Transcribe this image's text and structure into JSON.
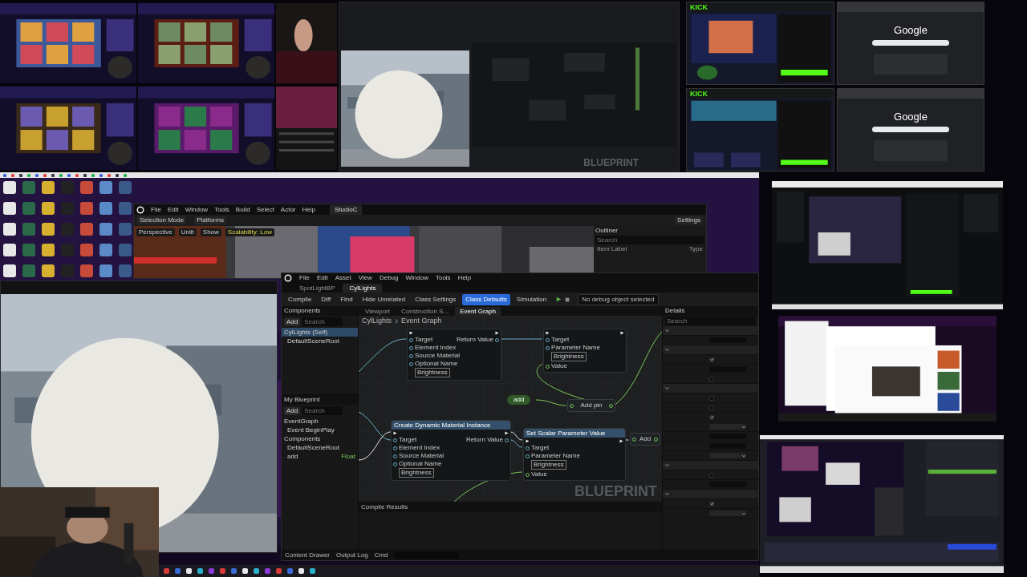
{
  "top_monitors": {
    "blueprint_preview": {
      "watermark": "BLUEPRINT"
    },
    "kick_windows": [
      {
        "logo": "KICK"
      },
      {
        "logo": "KICK"
      }
    ],
    "google_windows": [
      {
        "logo": "Google"
      },
      {
        "logo": "Google"
      }
    ]
  },
  "level_editor": {
    "menu": [
      "File",
      "Edit",
      "Window",
      "Tools",
      "Build",
      "Select",
      "Actor",
      "Help"
    ],
    "tab": "StudioC",
    "toolbar": [
      "Selection Mode",
      "Platforms",
      "Settings"
    ],
    "viewport_bar": [
      "Perspective",
      "Unlit",
      "Show",
      "Scalability: Low"
    ],
    "outliner": {
      "title": "Outliner",
      "placeholder": "Search",
      "columns": [
        "Item Label",
        "Type"
      ]
    }
  },
  "blueprint_editor": {
    "menu": [
      "File",
      "Edit",
      "Asset",
      "View",
      "Debug",
      "Window",
      "Tools",
      "Help"
    ],
    "tabs": [
      {
        "label": "SpotLightBP",
        "selected": false
      },
      {
        "label": "CylLights",
        "selected": true
      }
    ],
    "toolbar": [
      {
        "label": "Compile",
        "selected": false
      },
      {
        "label": "Diff",
        "selected": false
      },
      {
        "label": "Find",
        "selected": false
      },
      {
        "label": "Hide Unrelated",
        "selected": false
      },
      {
        "label": "Class Settings",
        "selected": false
      },
      {
        "label": "Class Defaults",
        "selected": true
      },
      {
        "label": "Simulation",
        "selected": false
      }
    ],
    "debug_filter": "No debug object selected",
    "components": {
      "title": "Components",
      "add": "Add",
      "placeholder": "Search",
      "tree": [
        {
          "label": "CylLights (Self)",
          "children": [
            {
              "label": "DefaultSceneRoot"
            }
          ]
        }
      ]
    },
    "my_blueprint": {
      "title": "My Blueprint",
      "add": "Add",
      "placeholder": "Search",
      "items": [
        {
          "label": "EventGraph",
          "children": [
            {
              "label": "Event BeginPlay"
            }
          ]
        },
        {
          "label": "Components",
          "children": [
            {
              "label": "DefaultSceneRoot"
            },
            {
              "label": "add",
              "type": "Float"
            }
          ]
        }
      ]
    },
    "graph_tabs": [
      {
        "label": "Viewport",
        "selected": false
      },
      {
        "label": "Construction S...",
        "selected": false
      },
      {
        "label": "Event Graph",
        "selected": true
      }
    ],
    "breadcrumb": [
      "CylLights",
      "Event Graph"
    ],
    "nodes": [
      {
        "kind": "function",
        "inputs": [
          {
            "label": "Target"
          },
          {
            "label": "Element Index"
          },
          {
            "label": "Source Material"
          },
          {
            "label": "Optional Name",
            "value": "Brightness"
          }
        ],
        "outputs": [
          {
            "label": "Return Value"
          }
        ]
      },
      {
        "kind": "function",
        "inputs": [
          {
            "label": "Target"
          },
          {
            "label": "Parameter Name",
            "value": "Brightness"
          },
          {
            "label": "Value"
          }
        ]
      },
      {
        "kind": "variable",
        "label": "add"
      },
      {
        "kind": "math",
        "label": "Add pin"
      },
      {
        "kind": "function",
        "title": "Create Dynamic Material Instance",
        "inputs": [
          {
            "label": "Target"
          },
          {
            "label": "Element Index"
          },
          {
            "label": "Source Material"
          },
          {
            "label": "Optional Name",
            "value": "Brightness"
          }
        ],
        "outputs": [
          {
            "label": "Return Value"
          }
        ]
      },
      {
        "kind": "function",
        "title": "Set Scalar Parameter Value",
        "inputs": [
          {
            "label": "Target"
          },
          {
            "label": "Parameter Name",
            "value": "Brightness"
          },
          {
            "label": "Value"
          }
        ]
      },
      {
        "kind": "math",
        "label": "Add"
      }
    ],
    "watermark": "BLUEPRINT",
    "compile_tab": "Compile Results",
    "details": {
      "title": "Details",
      "placeholder": "Search",
      "rows": [
        {
          "kind": "section",
          "expanded": true
        },
        {
          "kind": "field"
        },
        {
          "kind": "section",
          "expanded": true
        },
        {
          "kind": "check",
          "checked": true
        },
        {
          "kind": "field"
        },
        {
          "kind": "check",
          "checked": false
        },
        {
          "kind": "section",
          "expanded": true
        },
        {
          "kind": "check",
          "checked": false
        },
        {
          "kind": "check",
          "checked": false
        },
        {
          "kind": "check",
          "checked": true
        },
        {
          "kind": "dropdown"
        },
        {
          "kind": "field"
        },
        {
          "kind": "field"
        },
        {
          "kind": "dropdown"
        },
        {
          "kind": "section",
          "expanded": true
        },
        {
          "kind": "check",
          "checked": false
        },
        {
          "kind": "field"
        },
        {
          "kind": "section",
          "expanded": true
        },
        {
          "kind": "check",
          "checked": true
        },
        {
          "kind": "dropdown"
        }
      ]
    },
    "status_bar": [
      "Content Drawer",
      "Output Log",
      "Cmd"
    ]
  }
}
